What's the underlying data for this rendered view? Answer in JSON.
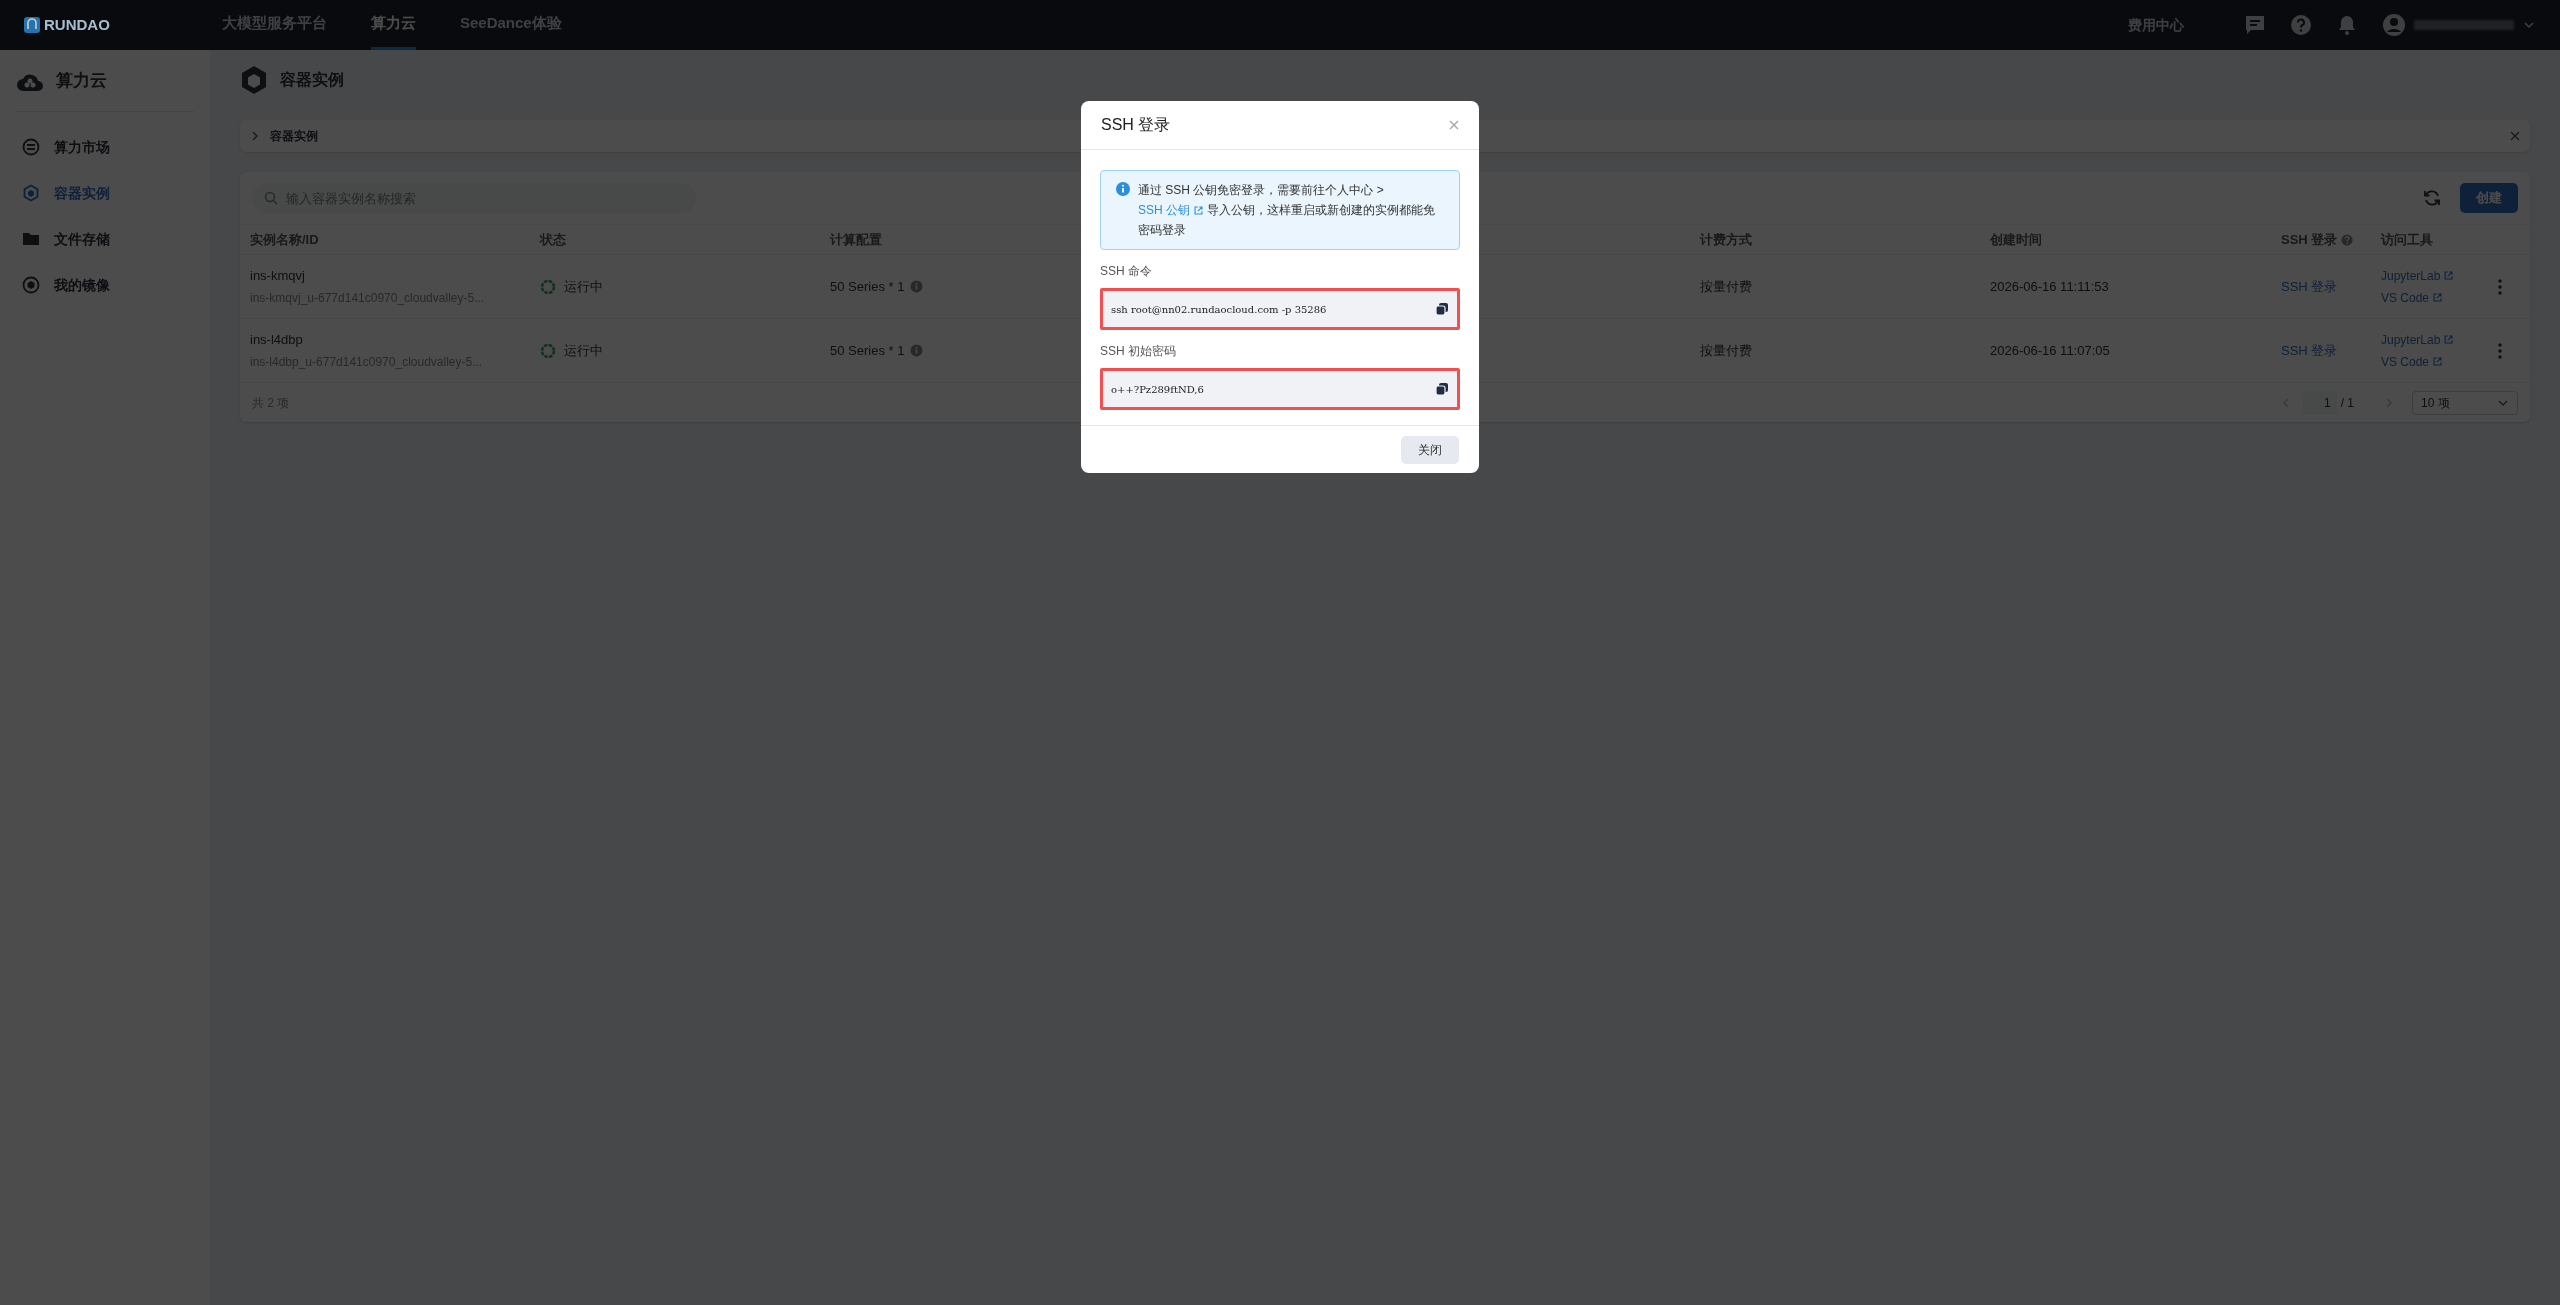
{
  "topbar": {
    "logo": "RUNDAO",
    "nav": [
      {
        "label": "大模型服务平台",
        "selected": false
      },
      {
        "label": "算力云",
        "selected": true
      },
      {
        "label": "SeeDance体验",
        "selected": false
      }
    ],
    "billing_link": "费用中心"
  },
  "sidebar": {
    "title": "算力云",
    "items": [
      {
        "label": "算力市场",
        "kind": "market",
        "selected": false
      },
      {
        "label": "容器实例",
        "kind": "container",
        "selected": true
      },
      {
        "label": "文件存储",
        "kind": "folder",
        "selected": false
      },
      {
        "label": "我的镜像",
        "kind": "image",
        "selected": false
      }
    ]
  },
  "page": {
    "title": "容器实例",
    "breadcrumb": "容器实例"
  },
  "toolbar": {
    "search": {
      "placeholder": "输入容器实例名称搜索"
    },
    "create_button": "创建"
  },
  "table": {
    "columns": [
      "实例名称/ID",
      "状态",
      "计算配置",
      "计费方式",
      "创建时间",
      "SSH 登录",
      "访问工具"
    ],
    "rows": [
      {
        "name": "ins-kmqvj",
        "id": "ins-kmqvj_u-677d141c0970_cloudvalley-5...",
        "status": "运行中",
        "config": "50 Series * 1",
        "billing": "按量付费",
        "created": "2026-06-16 11:11:53",
        "ssh": "SSH 登录",
        "tools": [
          "JupyterLab",
          "VS Code"
        ]
      },
      {
        "name": "ins-l4dbp",
        "id": "ins-l4dbp_u-677d141c0970_cloudvalley-5...",
        "status": "运行中",
        "config": "50 Series * 1",
        "billing": "按量付费",
        "created": "2026-06-16 11:07:05",
        "ssh": "SSH 登录",
        "tools": [
          "JupyterLab",
          "VS Code"
        ]
      }
    ]
  },
  "pagination": {
    "total": "共 2 项",
    "page": "1",
    "pages": "/ 1",
    "page_size": "10 项"
  },
  "dialog": {
    "title": "SSH 登录",
    "notice_before": "通过 SSH 公钥免密登录，需要前往个人中心 >",
    "notice_link": "SSH 公钥",
    "notice_after": "导入公钥，这样重启或新创建的实例都能免密码登录",
    "fields": [
      {
        "label": "SSH 命令",
        "value": "ssh root@nn02.rundaocloud.com -p 35286",
        "highlighted": true
      },
      {
        "label": "SSH 初始密码",
        "value": "o++?Pz289ftND,6",
        "highlighted": true
      }
    ],
    "close_button": "关闭"
  }
}
